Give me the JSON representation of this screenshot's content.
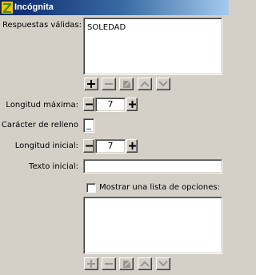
{
  "window": {
    "title": "Incógnita",
    "colors": {
      "titlebar_start": "#0a246a",
      "titlebar_end": "#a6caf0",
      "background": "#d4d0c8"
    }
  },
  "valid_answers": {
    "label": "Respuestas válidas:",
    "value": "SOLEDAD",
    "toolbar": [
      {
        "icon": "plus-icon",
        "enabled": true
      },
      {
        "icon": "minus-icon",
        "enabled": false
      },
      {
        "icon": "edit-icon",
        "enabled": false
      },
      {
        "icon": "arrow-up-icon",
        "enabled": false
      },
      {
        "icon": "arrow-down-icon",
        "enabled": false
      }
    ]
  },
  "max_length": {
    "label": "Longitud máxima:",
    "value": "7"
  },
  "fill_char": {
    "label": "Carácter de relleno",
    "value": "_"
  },
  "initial_length": {
    "label": "Longitud inicial:",
    "value": "7"
  },
  "initial_text": {
    "label": "Texto inicial:",
    "value": ""
  },
  "options_list": {
    "checkbox_label": "Mostrar una lista de opciones:",
    "checked": false,
    "items": [],
    "toolbar": [
      {
        "icon": "plus-icon",
        "enabled": false
      },
      {
        "icon": "minus-icon",
        "enabled": false
      },
      {
        "icon": "edit-icon",
        "enabled": false
      },
      {
        "icon": "arrow-up-icon",
        "enabled": false
      },
      {
        "icon": "arrow-down-icon",
        "enabled": false
      }
    ]
  }
}
